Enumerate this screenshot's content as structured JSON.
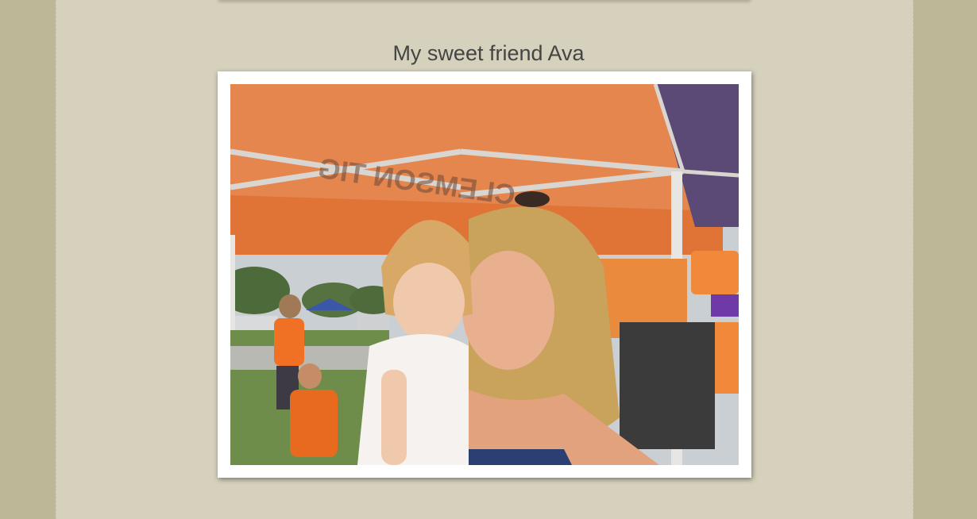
{
  "post": {
    "caption": "My sweet friend Ava",
    "photo": {
      "tent_text": "CLEMSON TIG"
    }
  },
  "colors": {
    "page_side": "#bdb797",
    "content_bg": "#d6d1bc",
    "tent_orange": "#e5864f",
    "tent_purple": "#5b4a76"
  }
}
